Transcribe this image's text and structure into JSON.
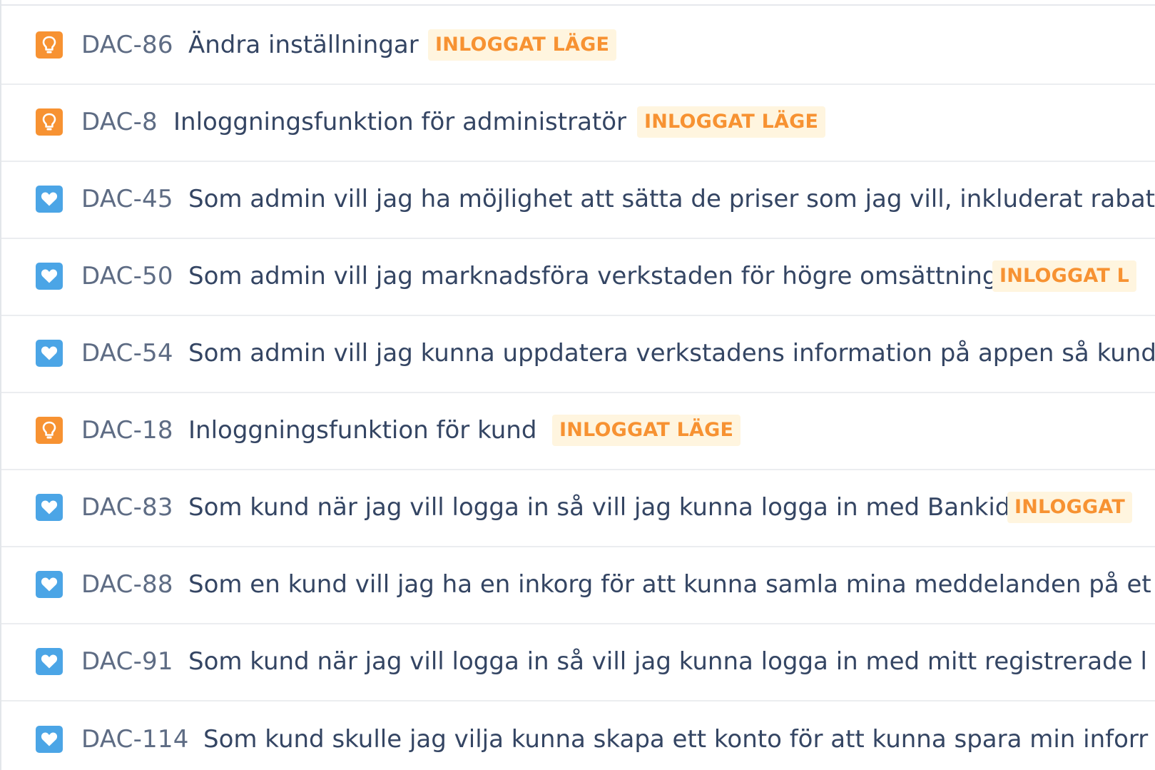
{
  "colors": {
    "improvement_icon": "#f79232",
    "story_icon": "#4ba5e6",
    "label_text": "#f79232",
    "label_bg": "#fff5df",
    "key_text": "#5e6c84",
    "summary_text": "#344563"
  },
  "issues": [
    {
      "type_icon": "lightbulb-icon",
      "key": "DAC-86",
      "summary": "Ändra inställningar",
      "label": "INLOGGAT LÄGE"
    },
    {
      "type_icon": "lightbulb-icon",
      "key": "DAC-8",
      "summary": "Inloggningsfunktion för administratör",
      "label": "INLOGGAT LÄGE"
    },
    {
      "type_icon": "heart-icon",
      "key": "DAC-45",
      "summary": "Som admin vill jag ha möjlighet att sätta de priser som jag vill, inkluderat rabat",
      "label": ""
    },
    {
      "type_icon": "heart-icon",
      "key": "DAC-50",
      "summary": "Som admin vill jag marknadsföra verkstaden för högre omsättning",
      "label": "INLOGGAT L"
    },
    {
      "type_icon": "heart-icon",
      "key": "DAC-54",
      "summary": "Som admin vill jag kunna uppdatera verkstadens information på appen så kund",
      "label": ""
    },
    {
      "type_icon": "lightbulb-icon",
      "key": "DAC-18",
      "summary": "Inloggningsfunktion för kund",
      "label": "INLOGGAT LÄGE"
    },
    {
      "type_icon": "heart-icon",
      "key": "DAC-83",
      "summary": "Som kund när jag vill logga in så vill jag kunna logga in med Bankid",
      "label": "INLOGGAT"
    },
    {
      "type_icon": "heart-icon",
      "key": "DAC-88",
      "summary": "Som en kund vill jag ha en inkorg för att kunna samla mina meddelanden på et",
      "label": ""
    },
    {
      "type_icon": "heart-icon",
      "key": "DAC-91",
      "summary": "Som kund när jag vill logga in så vill jag kunna logga in med mitt registrerade l",
      "label": ""
    },
    {
      "type_icon": "heart-icon",
      "key": "DAC-114",
      "summary": "Som kund skulle jag vilja kunna skapa ett konto för att kunna spara min inforr",
      "label": ""
    }
  ]
}
